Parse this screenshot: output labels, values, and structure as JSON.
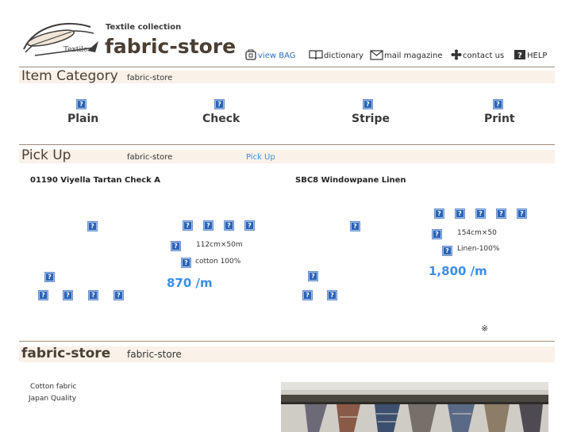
{
  "header": {
    "logo_word": "Textile",
    "tagline": "Textile collection",
    "site_name": "fabric-store"
  },
  "nav": {
    "view_bag": "view BAG",
    "dictionary": "dictionary",
    "mail_magazine": "mail magazine",
    "contact_us": "contact us",
    "help": "HELP"
  },
  "item_category": {
    "title": "Item Category",
    "subtitle": "fabric-store",
    "icon_glyph": "?",
    "items": [
      {
        "label": "Plain"
      },
      {
        "label": "Check"
      },
      {
        "label": "Stripe"
      },
      {
        "label": "Print"
      }
    ]
  },
  "pickup": {
    "title": "Pick Up",
    "subtitle": "fabric-store",
    "link": "Pick Up",
    "products": [
      {
        "name": "01190 Viyella Tartan Check A",
        "size": "112cm×50m",
        "material": "cotton 100%",
        "price": "870 /m"
      },
      {
        "name": "SBC8 Windowpane Linen",
        "size": "154cm×50",
        "material": "Linen-100%",
        "price": "1,800 /m"
      }
    ],
    "mark": "※"
  },
  "store_section": {
    "title": "fabric-store",
    "subtitle": "fabric-store",
    "text_line1": "Cotton fabric",
    "text_line2": "Japan Quality"
  },
  "colors": {
    "band": "#faf1e8",
    "price": "#3a8ee6",
    "link": "#3a8ee6",
    "brand": "#4a3f33"
  }
}
